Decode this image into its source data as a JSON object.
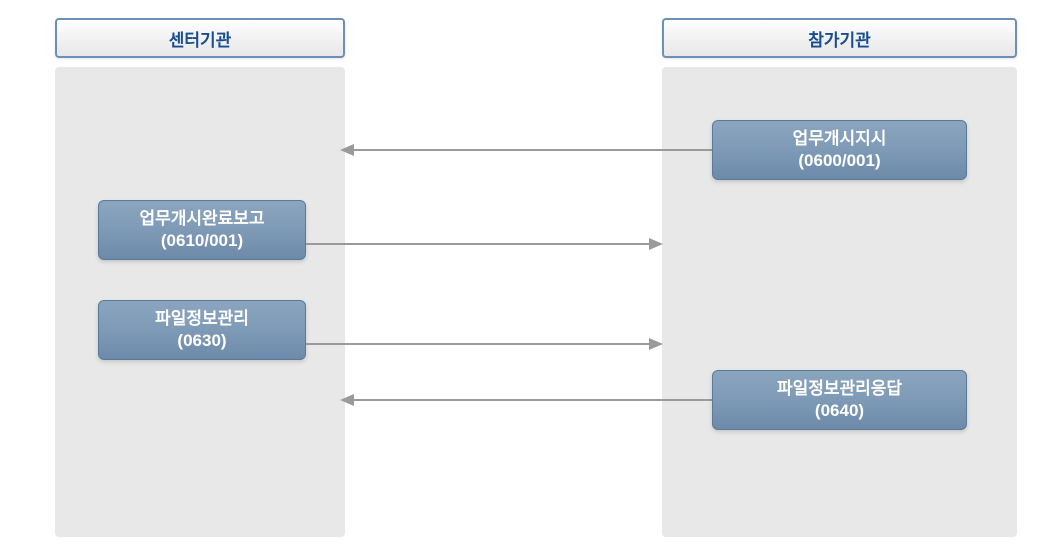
{
  "left": {
    "header": "센터기관",
    "messages": [
      {
        "title": "업무개시완료보고",
        "code": "(0610/001)"
      },
      {
        "title": "파일정보관리",
        "code": "(0630)"
      }
    ]
  },
  "right": {
    "header": "참가기관",
    "messages": [
      {
        "title": "업무개시지시",
        "code": "(0600/001)"
      },
      {
        "title": "파일정보관리응답",
        "code": "(0640)"
      }
    ]
  }
}
